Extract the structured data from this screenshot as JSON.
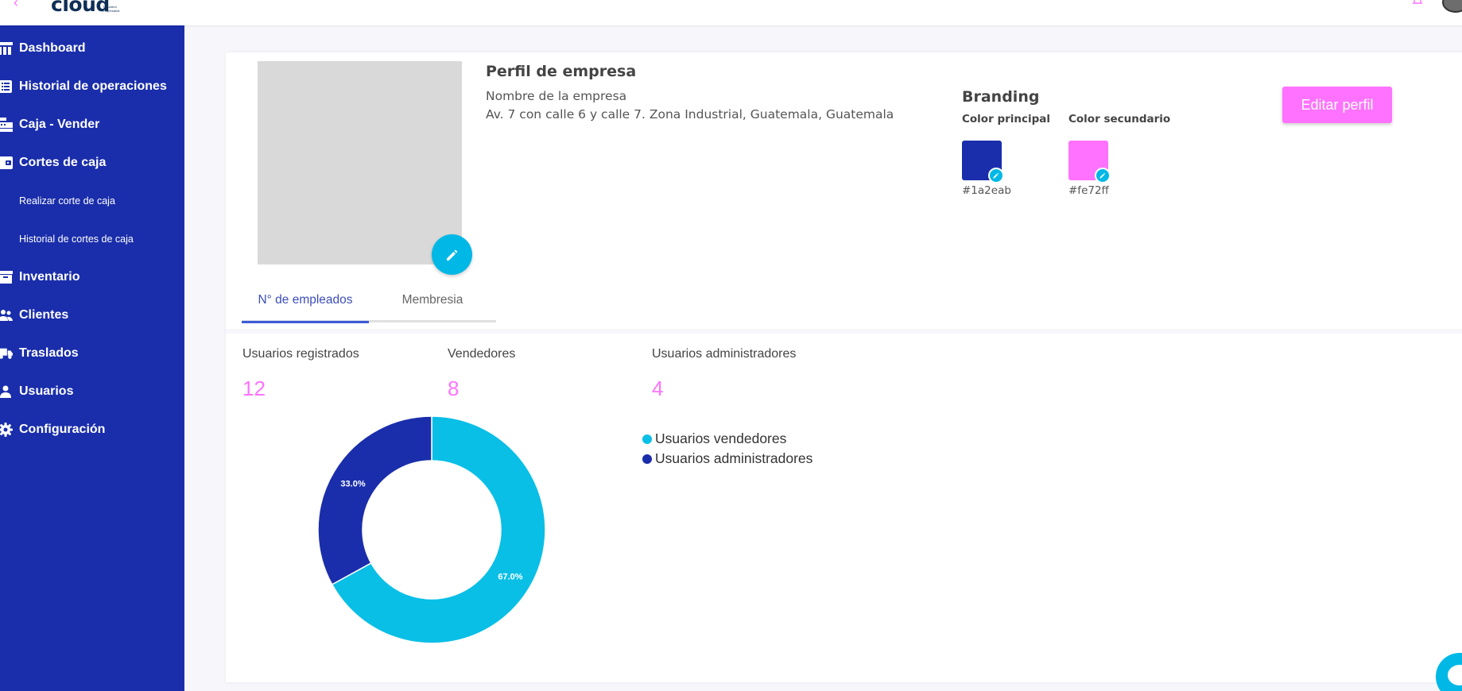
{
  "topbar": {
    "logo_text": "cloud",
    "logo_tagline": "Tu control Empresarial"
  },
  "sidebar": {
    "items": [
      {
        "label": "Dashboard",
        "icon": "dashboard-icon"
      },
      {
        "label": "Historial de operaciones",
        "icon": "list-icon"
      },
      {
        "label": "Caja - Vender",
        "icon": "cash-register-icon"
      },
      {
        "label": "Cortes de caja",
        "icon": "wallet-icon"
      },
      {
        "label": "Inventario",
        "icon": "archive-icon"
      },
      {
        "label": "Clientes",
        "icon": "people-icon"
      },
      {
        "label": "Traslados",
        "icon": "truck-icon"
      },
      {
        "label": "Usuarios",
        "icon": "person-icon"
      },
      {
        "label": "Configuración",
        "icon": "gear-icon"
      }
    ],
    "subitems": [
      {
        "label": "Realizar corte de caja"
      },
      {
        "label": "Historial de cortes de caja"
      }
    ]
  },
  "profile": {
    "title": "Perfil de empresa",
    "company_name": "Nombre de la empresa",
    "address": "Av. 7 con calle 6 y calle 7. Zona Industrial, Guatemala, Guatemala"
  },
  "branding": {
    "title": "Branding",
    "primary_label": "Color principal",
    "primary_hex": "#1a2eab",
    "secondary_label": "Color secundario",
    "secondary_hex": "#fe72ff"
  },
  "actions": {
    "edit_profile": "Editar perfil"
  },
  "tabs": [
    {
      "label": "N° de empleados",
      "active": true
    },
    {
      "label": "Membresia",
      "active": false
    }
  ],
  "stats": [
    {
      "label": "Usuarios registrados",
      "value": "12"
    },
    {
      "label": "Vendedores",
      "value": "8"
    },
    {
      "label": "Usuarios administradores",
      "value": "4"
    }
  ],
  "colors": {
    "sidebar": "#1a2eab",
    "accent": "#ff72ff",
    "cyan": "#00b8e6",
    "chart_cyan": "#0abfe6",
    "chart_navy": "#1a2eab"
  },
  "chart_data": {
    "type": "pie",
    "variant": "donut",
    "labels": [
      "Usuarios vendedores",
      "Usuarios administradores"
    ],
    "values": [
      67.0,
      33.0
    ],
    "data_labels": [
      "67.0%",
      "33.0%"
    ],
    "colors": [
      "#0abfe6",
      "#1a2eab"
    ],
    "legend_position": "right"
  }
}
